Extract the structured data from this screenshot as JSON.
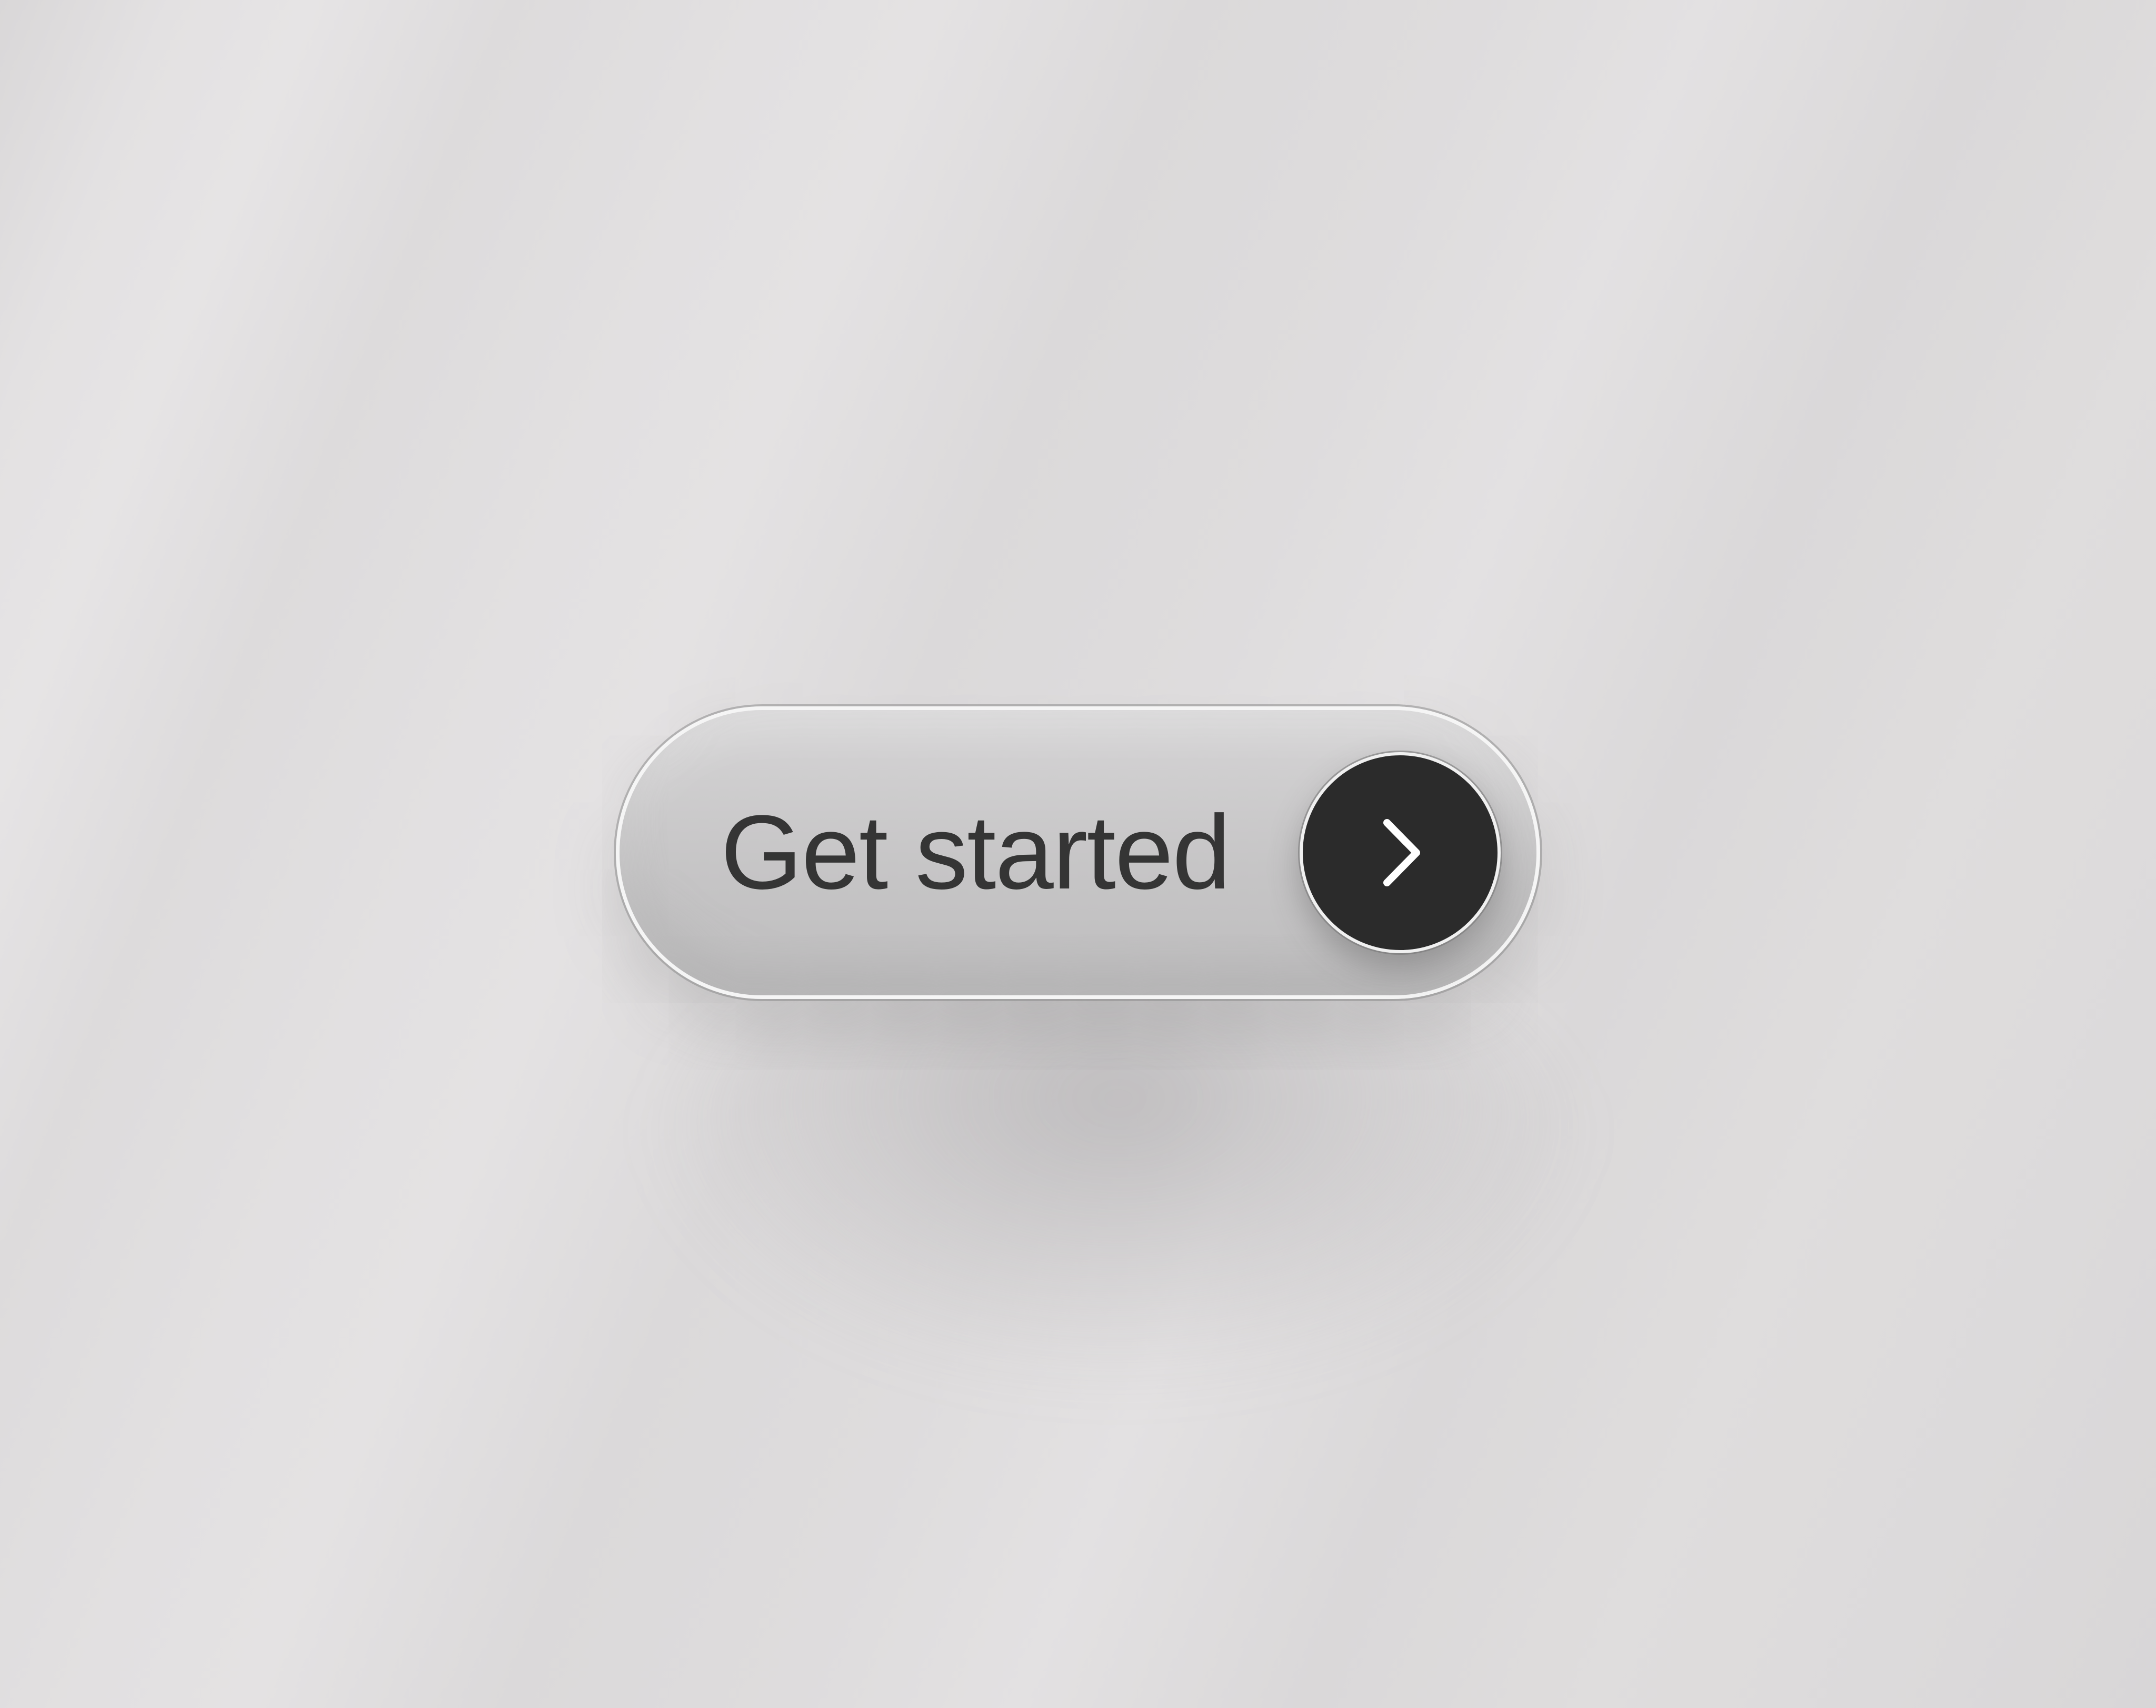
{
  "cta": {
    "label": "Get started",
    "icon": "chevron-right-icon"
  },
  "colors": {
    "background": "#dddbdc",
    "button_surface": "#c6c5c6",
    "button_rim": "#f5f5f5",
    "label_text": "#353535",
    "arrow_circle": "#2b2b2b",
    "arrow_icon": "#ffffff"
  }
}
